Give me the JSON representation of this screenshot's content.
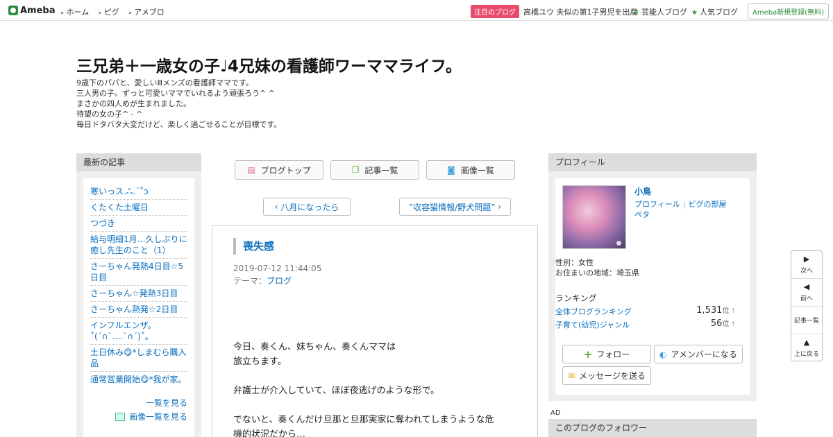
{
  "topbar": {
    "logo": "Ameba",
    "nav": [
      "ホーム",
      "ピグ",
      "アメブロ"
    ],
    "pick_badge": "注目のブログ",
    "pick_text": "高橋ユウ 夫似の第1子男児を出産",
    "celeb_link": "芸能人ブログ",
    "popular_link": "人気ブログ",
    "register": "Ameba新規登録(無料)"
  },
  "header": {
    "title": "三兄弟＋一歳女の子♩4兄妹の看護師ワーママライフ。",
    "description": [
      "9歳下のパパと、愛しいⅢメンズの看護師ママです。",
      "三人男の子。ずっと可愛いママでいれるよう頑張ろう^ ^",
      "まさかの四人めが生まれました。",
      "待望の女の子^ - ^",
      "毎日ドタバタ大変だけど、楽しく過ごせることが目標です。"
    ]
  },
  "left": {
    "heading": "最新の記事",
    "items": [
      "寒いっス.ஃ.ˊ˚ↄ",
      "くたくた土曜日",
      "つづき",
      "給与明細1月…久しぶりに癒し先生のこと（1）",
      "さーちゃん発熱4日目☆5日目",
      "さーちゃん☆発熱3日目",
      "さーちゃん熱発☆2日目",
      "インフルエンザ。˚(ˊ∩ˋ….ˋ∩ˊ)˚。",
      "土日休み😋*しまむら購入品",
      "通常営業開始😋*我が家。"
    ],
    "see_all": "一覧を見る",
    "see_images": "画像一覧を見る"
  },
  "center": {
    "buttons": {
      "top": "ブログトップ",
      "list": "記事一覧",
      "images": "画像一覧"
    },
    "prev": "八月になったら",
    "next": "”収容猫情報/野犬問題”",
    "article": {
      "title": "喪失感",
      "date": "2019-07-12 11:44:05",
      "theme_label": "テーマ：",
      "theme": "ブログ",
      "body": [
        "今日、奏くん、妹ちゃん、奏くんママは",
        "旅立ちます。",
        "弁護士が介入していて、ほぼ夜逃げのような形で。",
        "でないと、奏くんだけ旦那と旦那実家に奪われてしまうような危",
        "機的状況だから…"
      ]
    }
  },
  "right": {
    "heading": "プロフィール",
    "name": "小鳥",
    "links": [
      "プロフィール",
      "ピグの部屋",
      "ペタ"
    ],
    "gender": "性別：女性",
    "region": "お住まいの地域：埼玉県",
    "ranking_heading": "ランキング",
    "rankings": [
      {
        "label": "全体ブログランキング",
        "value": "1,531",
        "unit": "位",
        "arrow": "↑"
      },
      {
        "label": "子育て(幼児)ジャンル",
        "value": "56",
        "unit": "位",
        "arrow": "↑"
      }
    ],
    "follow": "フォロー",
    "amember": "アメンバーになる",
    "message": "メッセージを送る",
    "ad": "AD",
    "followers_heading": "このブログのフォロワー"
  },
  "sidenav": {
    "next": "次へ",
    "prev": "前へ",
    "list": "記事一覧",
    "top": "上に戻る"
  }
}
